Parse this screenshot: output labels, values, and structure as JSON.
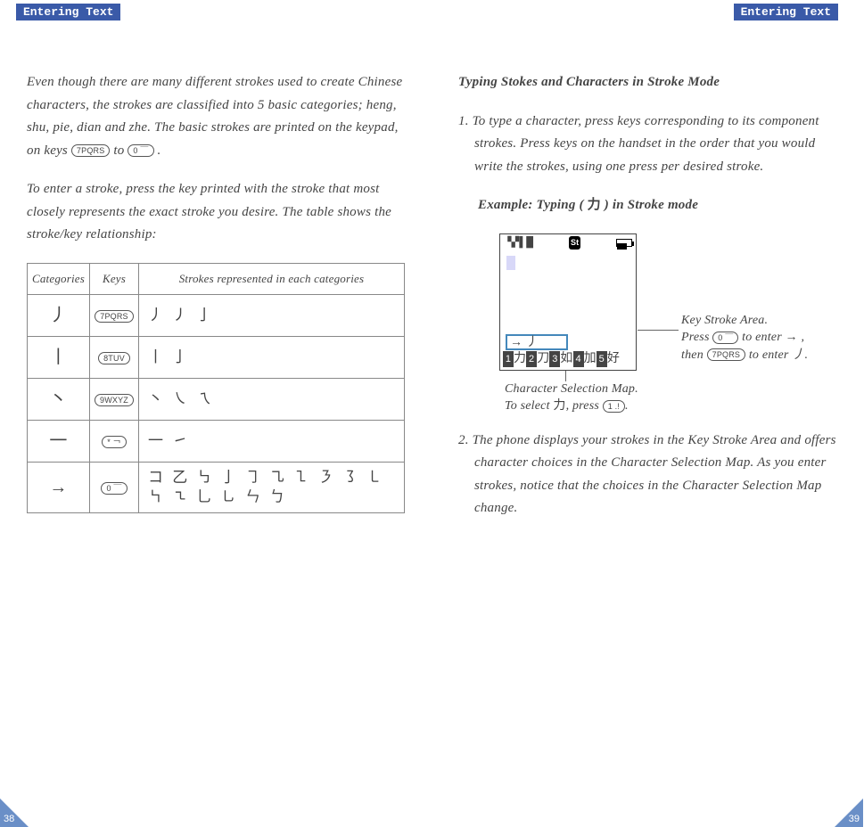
{
  "header_tab": "Entering Text",
  "left_page": {
    "para1_a": "Even though there are many different strokes used to create Chinese characters, the strokes are classified into 5 basic categories; heng, shu, pie, dian and zhe. The basic strokes are printed on the keypad, on keys ",
    "key7": "7PQRS",
    "para1_mid": " to ",
    "key0": "0 ￣",
    "para1_end": ".",
    "para2": "To enter a stroke, press the key printed with the stroke that most closely represents the exact stroke you desire. The table shows the stroke/key relationship:",
    "table": {
      "h1": "Categories",
      "h2": "Keys",
      "h3": "Strokes represented in each categories",
      "rows": [
        {
          "cat": "丿",
          "key": "7PQRS",
          "rep": "丿 ㇓ 亅"
        },
        {
          "cat": "丨",
          "key": "8TUV",
          "rep": "丨 亅"
        },
        {
          "cat": "丶",
          "key": "9WXYZ",
          "rep": "丶 ㇏ ㇝"
        },
        {
          "cat": "一",
          "key": "* ￢",
          "rep": "一 ㇀"
        },
        {
          "cat": "→",
          "key": "0 ￣",
          "rep": "コ 乙 ㇉ 亅 ㇆ ㇈ ㇅ ㇋ ㇌ ㇄ ㇞ ㇍ 乚 ㇟ ㄣ ㄅ"
        }
      ]
    },
    "pagenum": "38"
  },
  "right_page": {
    "heading": "Typing Stokes and Characters in Stroke Mode",
    "step1": "1. To type a character, press keys corresponding to its component strokes. Press keys on the handset in the order that you would write the strokes, using one press per desired stroke.",
    "example_a": "Example: Typing ( ",
    "example_char": "力",
    "example_b": " ) in Stroke mode",
    "phone": {
      "st_label": "St",
      "stroke_area": "→  丿",
      "selmap": [
        {
          "n": "1",
          "c": "力"
        },
        {
          "n": "2",
          "c": "刀"
        },
        {
          "n": "3",
          "c": "如"
        },
        {
          "n": "4",
          "c": "加"
        },
        {
          "n": "5",
          "c": "好"
        }
      ]
    },
    "ann_right_a": "Key Stroke Area.",
    "ann_right_b": "Press ",
    "ann_right_key1": "0 ￣",
    "ann_right_c": " to enter  → ,",
    "ann_right_d": "then  ",
    "ann_right_key2": "7PQRS",
    "ann_right_e": " to enter  丿.",
    "ann_bottom_a": "Character Selection Map.",
    "ann_bottom_b": "To select  ",
    "ann_bottom_char": "力",
    "ann_bottom_c": ", press  ",
    "ann_bottom_key": "1 .!",
    "ann_bottom_d": ".",
    "step2": "2. The phone displays your strokes in the Key Stroke Area and offers character choices in the Character Selection Map. As you enter strokes, notice that the choices in the Character Selection Map change.",
    "pagenum": "39"
  }
}
